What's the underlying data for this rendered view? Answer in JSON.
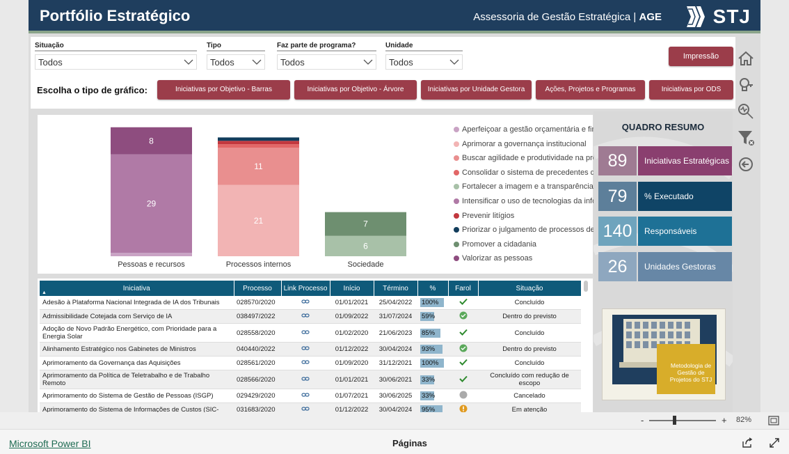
{
  "header": {
    "title": "Portfólio Estratégico",
    "org": "Assessoria de Gestão Estratégica | ",
    "org_bold": "AGE",
    "logo_text": "STJ"
  },
  "filters": [
    {
      "label": "Situação",
      "value": "Todos"
    },
    {
      "label": "Tipo",
      "value": "Todos"
    },
    {
      "label": "Faz parte de programa?",
      "value": "Todos"
    },
    {
      "label": "Unidade",
      "value": "Todos"
    }
  ],
  "print_button": "Impressão",
  "chart_chooser": {
    "label": "Escolha o tipo de gráfico:",
    "buttons": [
      "Iniciativas por Objetivo - Barras",
      "Iniciativas por Objetivo - Árvore",
      "Iniciativas por Unidade Gestora",
      "Ações, Projetos e Programas",
      "Iniciativas por ODS"
    ]
  },
  "chart_data": {
    "type": "bar",
    "stacked": true,
    "categories": [
      "Pessoas e recursos",
      "Processos internos",
      "Sociedade"
    ],
    "series": [
      {
        "name": "Aperfeiçoar a gestão orçamentária e financ...",
        "color": "#c9a3c4",
        "values": [
          1,
          0,
          0
        ]
      },
      {
        "name": "Aprimorar a governança institucional",
        "color": "#f2b4b4",
        "values": [
          0,
          21,
          0
        ]
      },
      {
        "name": "Buscar agilidade e produtividade na presta...",
        "color": "#e98f8f",
        "values": [
          0,
          11,
          0
        ]
      },
      {
        "name": "Consolidar o sistema de precedentes qualifi...",
        "color": "#e26767",
        "values": [
          0,
          1,
          0
        ]
      },
      {
        "name": "Fortalecer a imagem e a transparência insti...",
        "color": "#a8c1a8",
        "values": [
          0,
          0,
          6
        ]
      },
      {
        "name": "Intensificar o uso de tecnologias da inform...",
        "color": "#b07aa6",
        "values": [
          29,
          0,
          0
        ]
      },
      {
        "name": "Prevenir litígios",
        "color": "#c2383e",
        "values": [
          0,
          1,
          0
        ]
      },
      {
        "name": "Priorizar o julgamento de processos de corr...",
        "color": "#123d5c",
        "values": [
          0,
          1,
          0
        ]
      },
      {
        "name": "Promover a cidadania",
        "color": "#6e8f70",
        "values": [
          0,
          0,
          7
        ]
      },
      {
        "name": "Valorizar as pessoas",
        "color": "#8e4d7f",
        "values": [
          8,
          0,
          0
        ]
      }
    ],
    "stack_order": [
      [
        "Aperfeiçoar a gestão orçamentária e financ...",
        "Intensificar o uso de tecnologias da inform...",
        "Valorizar as pessoas"
      ],
      [
        "Aprimorar a governança institucional",
        "Buscar agilidade e produtividade na presta...",
        "Consolidar o sistema de precedentes qualifi...",
        "Prevenir litígios",
        "Priorizar o julgamento de processos de corr..."
      ],
      [
        "Fortalecer a imagem e a transparência insti...",
        "Promover a cidadania"
      ]
    ],
    "data_labels_shown": [
      [
        "29",
        "8"
      ],
      [
        "21",
        "11"
      ],
      [
        "6",
        "7"
      ]
    ],
    "ylim": [
      0,
      40
    ],
    "legend_position": "right",
    "grid": false
  },
  "table": {
    "columns": [
      "Iniciativa",
      "Processo",
      "Link Processo",
      "Início",
      "Término",
      "%",
      "Farol",
      "Situação"
    ],
    "rows": [
      {
        "iniciativa": "Adesão à Plataforma Nacional Integrada de IA dos Tribunais",
        "processo": "028570/2020",
        "inicio": "01/01/2021",
        "termino": "25/04/2022",
        "pct": "100%",
        "pct_value": 100,
        "farol": "check",
        "situacao": "Concluído"
      },
      {
        "iniciativa": "Admissibilidade Cotejada com Serviço de IA",
        "processo": "038497/2022",
        "inicio": "01/09/2022",
        "termino": "31/07/2024",
        "pct": "59%",
        "pct_value": 59,
        "farol": "green-circle",
        "situacao": "Dentro do previsto"
      },
      {
        "iniciativa": "Adoção de Novo Padrão Energético, com Prioridade para a Energia Solar",
        "processo": "028558/2020",
        "inicio": "01/02/2020",
        "termino": "21/06/2023",
        "pct": "85%",
        "pct_value": 85,
        "farol": "check",
        "situacao": "Concluído"
      },
      {
        "iniciativa": "Alinhamento Estratégico nos Gabinetes de Ministros",
        "processo": "040440/2022",
        "inicio": "01/12/2022",
        "termino": "30/04/2024",
        "pct": "93%",
        "pct_value": 93,
        "farol": "green-circle",
        "situacao": "Dentro do previsto"
      },
      {
        "iniciativa": "Aprimoramento da Governança das Aquisições",
        "processo": "028561/2020",
        "inicio": "01/09/2020",
        "termino": "31/12/2021",
        "pct": "100%",
        "pct_value": 100,
        "farol": "check",
        "situacao": "Concluído"
      },
      {
        "iniciativa": "Aprimoramento da Política de Teletrabalho e de Trabalho Remoto",
        "processo": "028566/2020",
        "inicio": "01/01/2021",
        "termino": "30/06/2021",
        "pct": "33%",
        "pct_value": 33,
        "farol": "check",
        "situacao": "Concluído com redução de escopo"
      },
      {
        "iniciativa": "Aprimoramento do Sistema de Gestão de Pessoas (ISGP)",
        "processo": "029429/2020",
        "inicio": "01/07/2021",
        "termino": "30/06/2025",
        "pct": "33%",
        "pct_value": 33,
        "farol": "gray-circle",
        "situacao": "Cancelado"
      },
      {
        "iniciativa": "Aprimoramento do Sistema de Informações de Custos (SIC-",
        "processo": "031683/2020",
        "inicio": "01/12/2022",
        "termino": "30/04/2024",
        "pct": "95%",
        "pct_value": 95,
        "farol": "warning",
        "situacao": "Em atenção"
      }
    ]
  },
  "summary": {
    "title": "QUADRO RESUMO",
    "kpis": [
      {
        "value": "89",
        "label": "Iniciativas Estratégicas",
        "num_color": "#9f7b93",
        "lbl_color": "#8a3f6f"
      },
      {
        "value": "79",
        "label": "% Executado",
        "num_color": "#5d7f9a",
        "lbl_color": "#0f4466"
      },
      {
        "value": "140",
        "label": "Responsáveis",
        "num_color": "#6fa4bd",
        "lbl_color": "#1e7196"
      },
      {
        "value": "26",
        "label": "Unidades Gestoras",
        "num_color": "#8ea7bf",
        "lbl_color": "#6787a6"
      }
    ],
    "promo_text": "Metodologia de Gestão de Projetos do STJ"
  },
  "zoom": {
    "minus": "-",
    "plus": "+",
    "level": "82%"
  },
  "footer": {
    "powerbi": "Microsoft Power BI",
    "pages": "Páginas"
  }
}
